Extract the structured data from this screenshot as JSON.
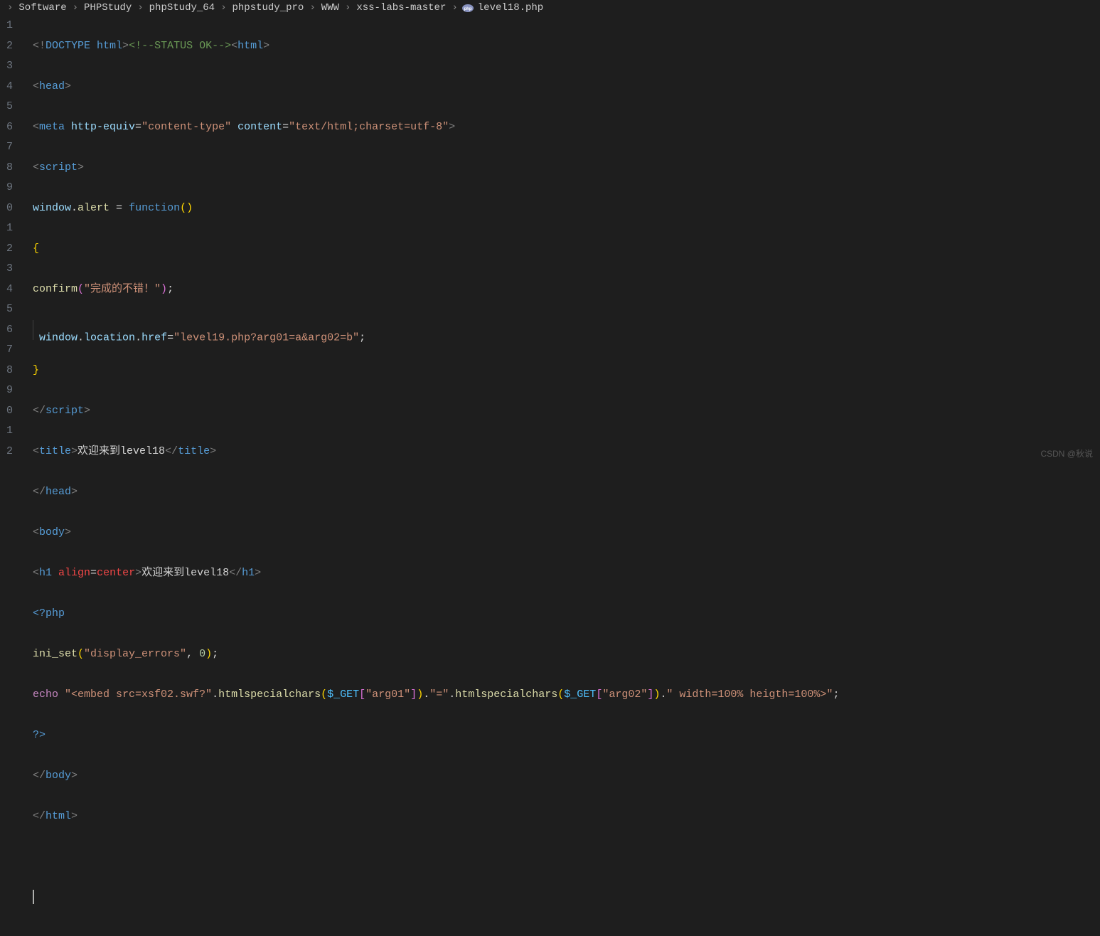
{
  "breadcrumbs": {
    "items": [
      "Software",
      "PHPStudy",
      "phpStudy_64",
      "phpstudy_pro",
      "WWW",
      "xss-labs-master"
    ],
    "file": "level18.php",
    "sep": "›"
  },
  "gutter": {
    "start_visible": [
      "1",
      "2",
      "3",
      "4",
      "5",
      "6",
      "7",
      "8",
      "9",
      "0",
      "1",
      "2",
      "3",
      "4",
      "5",
      "6",
      "7",
      "8",
      "9",
      "0",
      "1",
      "2"
    ]
  },
  "code": {
    "l1": {
      "a": "<!",
      "b": "DOCTYPE ",
      "c": "html",
      "d": ">",
      "e": "<!--STATUS OK-->",
      "f": "<",
      "g": "html",
      "h": ">"
    },
    "l2": {
      "a": "<",
      "b": "head",
      "c": ">"
    },
    "l3": {
      "a": "<",
      "b": "meta ",
      "c": "http-equiv",
      "d": "=",
      "e": "\"content-type\"",
      "f": " content",
      "g": "=",
      "h": "\"text/html;charset=utf-8\"",
      "i": ">"
    },
    "l4": {
      "a": "<",
      "b": "script",
      "c": ">"
    },
    "l5": {
      "a": "window",
      "b": ".",
      "c": "alert",
      "d": " = ",
      "e": "function",
      "f": "()"
    },
    "l6": {
      "a": "{"
    },
    "l7": {
      "a": "confirm",
      "b": "(",
      "c": "\"完成的不错！\"",
      "d": ")",
      "e": ";"
    },
    "l8": {
      "ind": " ",
      "a": "window",
      "b": ".",
      "c": "location",
      "d": ".",
      "e": "href",
      "f": "=",
      "g": "\"level19.php?arg01=a&arg02=b\"",
      "h": ";"
    },
    "l9": {
      "a": "}"
    },
    "l10": {
      "a": "</",
      "b": "script",
      "c": ">"
    },
    "l11": {
      "a": "<",
      "b": "title",
      "c": ">",
      "d": "欢迎来到level18",
      "e": "</",
      "f": "title",
      "g": ">"
    },
    "l12": {
      "a": "</",
      "b": "head",
      "c": ">"
    },
    "l13": {
      "a": "<",
      "b": "body",
      "c": ">"
    },
    "l14": {
      "a": "<",
      "b": "h1 ",
      "c": "align",
      "d": "=",
      "e": "center",
      "f": ">",
      "g": "欢迎来到level18",
      "h": "</",
      "i": "h1",
      "j": ">"
    },
    "l15": {
      "a": "<?php"
    },
    "l16": {
      "a": "ini_set",
      "b": "(",
      "c": "\"display_errors\"",
      "d": ", ",
      "e": "0",
      "f": ")",
      "g": ";"
    },
    "l17": {
      "a": "echo ",
      "b": "\"<embed src=xsf02.swf?\"",
      "c": ".",
      "d": "htmlspecialchars",
      "e": "(",
      "f": "$_GET",
      "g": "[",
      "h": "\"arg01\"",
      "i": "]",
      "j": ")",
      "k": ".",
      "l": "\"=\"",
      "m": ".",
      "n": "htmlspecialchars",
      "o": "(",
      "p": "$_GET",
      "q": "[",
      "r": "\"arg02\"",
      "s": "]",
      "t": ")",
      "u": ".",
      "v": "\" width=100% heigth=100%>\"",
      "w": ";"
    },
    "l18": {
      "a": "?>"
    },
    "l19": {
      "a": "</",
      "b": "body",
      "c": ">"
    },
    "l20": {
      "a": "</",
      "b": "html",
      "c": ">"
    }
  },
  "watermark": "CSDN @秋说"
}
